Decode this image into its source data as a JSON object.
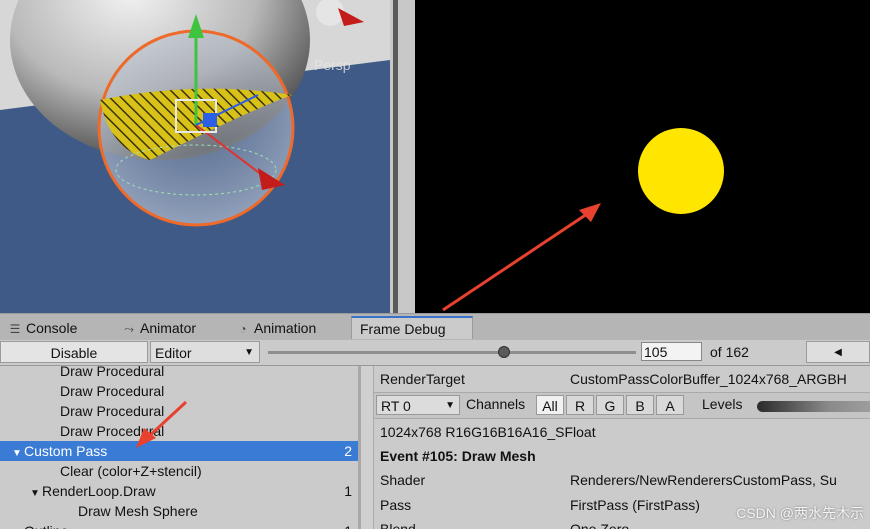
{
  "scene_view": {
    "projection_label": "Persp"
  },
  "game_view": {
    "circle_color": "#ffe600"
  },
  "tabs": [
    {
      "label": "Console",
      "icon": "console-icon"
    },
    {
      "label": "Animator",
      "icon": "animator-icon"
    },
    {
      "label": "Animation",
      "icon": "animation-icon"
    },
    {
      "label": "Frame Debug",
      "active": true
    }
  ],
  "toolbar": {
    "disable_label": "Disable",
    "target_label": "Editor",
    "event_index": "105",
    "event_total_label": "of 162",
    "slider_fraction": 0.64
  },
  "tree": [
    {
      "label": "Draw Procedural",
      "indent": 3,
      "count": ""
    },
    {
      "label": "Draw Procedural",
      "indent": 3,
      "count": ""
    },
    {
      "label": "Draw Procedural",
      "indent": 3,
      "count": ""
    },
    {
      "label": "Draw Procedural",
      "indent": 3,
      "count": ""
    },
    {
      "label": "Custom Pass",
      "indent": 1,
      "count": "2",
      "expanded": true,
      "selected": true
    },
    {
      "label": "Clear (color+Z+stencil)",
      "indent": 3,
      "count": ""
    },
    {
      "label": "RenderLoop.Draw",
      "indent": 2,
      "count": "1",
      "expanded": true
    },
    {
      "label": "Draw Mesh Sphere",
      "indent": 4,
      "count": ""
    },
    {
      "label": "Outline",
      "indent": 1,
      "count": "1",
      "expanded": true
    }
  ],
  "detail": {
    "render_target_key": "RenderTarget",
    "render_target_value": "CustomPassColorBuffer_1024x768_ARGBH",
    "rt_select": "RT 0",
    "channels_label": "Channels",
    "channels": [
      "All",
      "R",
      "G",
      "B",
      "A"
    ],
    "levels_label": "Levels",
    "format": "1024x768 R16G16B16A16_SFloat",
    "event_title": "Event #105: Draw Mesh",
    "shader_key": "Shader",
    "shader_value": "Renderers/NewRenderersCustomPass, Su",
    "pass_key": "Pass",
    "pass_value": "FirstPass (FirstPass)",
    "blend_key": "Blend",
    "blend_value": "One Zero"
  },
  "watermark": "CSDN @两水先木示",
  "colors": {
    "selection": "#3a7bd5",
    "annotation_arrow": "#e8412f",
    "tab_accent": "#3a72c9"
  }
}
